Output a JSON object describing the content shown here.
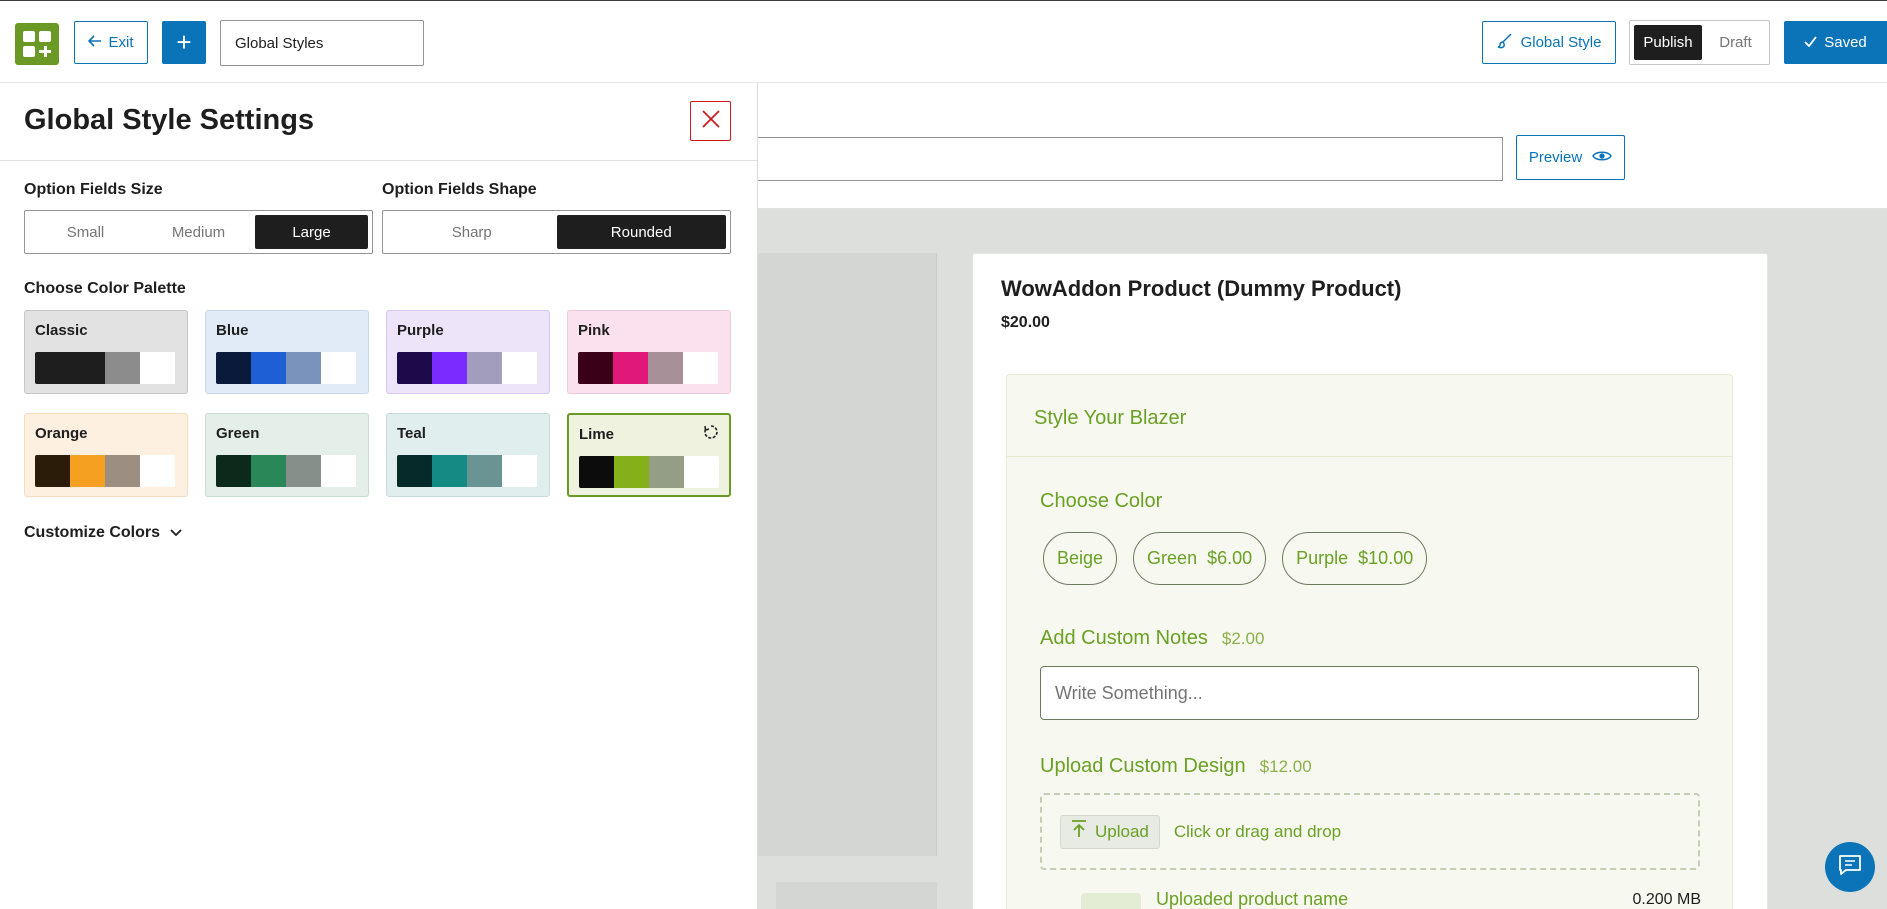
{
  "topbar": {
    "exit_label": "Exit",
    "add_label": "+",
    "title_value": "Global Styles",
    "global_style_label": "Global Style",
    "publish_label": "Publish",
    "draft_label": "Draft",
    "saved_label": "Saved"
  },
  "panel": {
    "title": "Global Style Settings",
    "size_label": "Option Fields Size",
    "size_options": [
      "Small",
      "Medium",
      "Large"
    ],
    "size_selected": "Large",
    "shape_label": "Option Fields Shape",
    "shape_options": [
      "Sharp",
      "Rounded"
    ],
    "shape_selected": "Rounded",
    "palette_label": "Choose Color Palette",
    "palettes": [
      {
        "name": "Classic",
        "bg": "#e2e2e2",
        "border": "#c6c6c6",
        "colors": [
          "#1e1e1e",
          "#1e1e1e",
          "#8c8c8c",
          "#ffffff"
        ]
      },
      {
        "name": "Blue",
        "bg": "#e1ebf8",
        "border": "#c8d8ee",
        "colors": [
          "#0a1a3a",
          "#1e5fd6",
          "#7a93bd",
          "#ffffff"
        ]
      },
      {
        "name": "Purple",
        "bg": "#ede4f9",
        "border": "#d8c8f0",
        "colors": [
          "#1c0a4a",
          "#7a2bff",
          "#a29cbd",
          "#ffffff"
        ]
      },
      {
        "name": "Pink",
        "bg": "#fbe1ee",
        "border": "#f0c8dc",
        "colors": [
          "#3a0018",
          "#e0187a",
          "#a89098",
          "#ffffff"
        ]
      },
      {
        "name": "Orange",
        "bg": "#fdf0e0",
        "border": "#f3dcc0",
        "colors": [
          "#2a1c08",
          "#f5a020",
          "#9c8e80",
          "#ffffff"
        ]
      },
      {
        "name": "Green",
        "bg": "#e3efe8",
        "border": "#c8dccf",
        "colors": [
          "#0c2a1c",
          "#2a8858",
          "#86908a",
          "#ffffff"
        ]
      },
      {
        "name": "Teal",
        "bg": "#e0eeee",
        "border": "#c6dcdc",
        "colors": [
          "#062a2a",
          "#148a84",
          "#6a9494",
          "#ffffff"
        ]
      },
      {
        "name": "Lime",
        "bg": "#eef2de",
        "border": "#6a9a25",
        "colors": [
          "#0c0c0c",
          "#86b01a",
          "#949e86",
          "#ffffff"
        ]
      }
    ],
    "selected_palette": "Lime",
    "customize_label": "Customize Colors"
  },
  "preview": {
    "preview_label": "Preview",
    "product_title": "WowAddon Product (Dummy Product)",
    "product_price": "$20.00",
    "addon_title": "Style Your Blazer",
    "color_field": {
      "label": "Choose Color",
      "options": [
        {
          "name": "Beige",
          "price": ""
        },
        {
          "name": "Green",
          "price": "$6.00"
        },
        {
          "name": "Purple",
          "price": "$10.00"
        }
      ]
    },
    "notes_field": {
      "label": "Add Custom Notes",
      "price": "$2.00",
      "placeholder": "Write Something..."
    },
    "upload_field": {
      "label": "Upload Custom Design",
      "price": "$12.00",
      "button_label": "Upload",
      "hint": "Click or drag and drop",
      "file_name": "Uploaded product name",
      "file_size": "0.200 MB"
    }
  },
  "colors": {
    "accent_blue": "#0b73b8",
    "lime_green": "#6aa024",
    "close_red": "#cc1818"
  }
}
